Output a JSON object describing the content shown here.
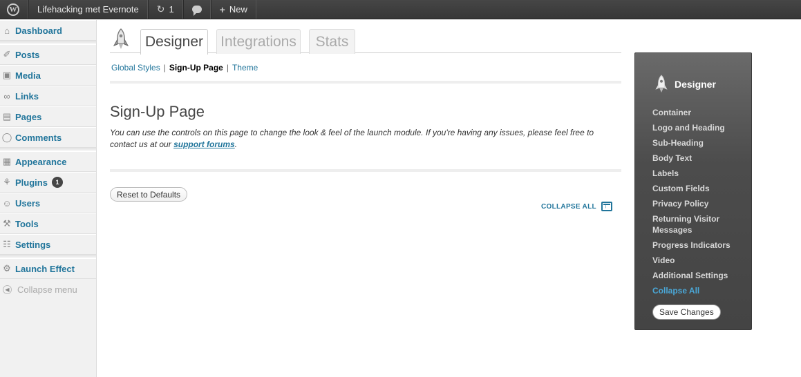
{
  "adminbar": {
    "site_name": "Lifehacking met Evernote",
    "updates_count": "1",
    "new_label": "New",
    "logo_letter": "W"
  },
  "menu": {
    "items": [
      {
        "label": "Dashboard",
        "icon": "home-icon"
      },
      {
        "label": "Posts",
        "icon": "pushpin-icon"
      },
      {
        "label": "Media",
        "icon": "media-icon"
      },
      {
        "label": "Links",
        "icon": "link-icon"
      },
      {
        "label": "Pages",
        "icon": "pages-icon"
      },
      {
        "label": "Comments",
        "icon": "comment-icon"
      },
      {
        "label": "Appearance",
        "icon": "appearance-icon"
      },
      {
        "label": "Plugins",
        "icon": "plugin-icon",
        "badge": "1"
      },
      {
        "label": "Users",
        "icon": "users-icon"
      },
      {
        "label": "Tools",
        "icon": "tools-icon"
      },
      {
        "label": "Settings",
        "icon": "settings-icon"
      },
      {
        "label": "Launch Effect",
        "icon": "launch-effect-icon"
      }
    ],
    "collapse_label": "Collapse menu"
  },
  "tabs": [
    "Designer",
    "Integrations",
    "Stats"
  ],
  "subnav": {
    "items": [
      "Global Styles",
      "Sign-Up Page",
      "Theme"
    ],
    "current": "Sign-Up Page",
    "separator": "|"
  },
  "page": {
    "title": "Sign-Up Page",
    "description": "You can use the controls on this page to change the look & feel of the launch module. If you're having any issues, please feel free to contact us at our ",
    "link_text": "support forums",
    "description_end": ".",
    "reset_label": "Reset to Defaults",
    "collapse_all_label": "COLLAPSE ALL"
  },
  "panel": {
    "title": "Designer",
    "links": [
      "Container",
      "Logo and Heading",
      "Sub-Heading",
      "Body Text",
      "Labels",
      "Custom Fields",
      "Privacy Policy",
      "Returning Visitor Messages",
      "Progress Indicators",
      "Video",
      "Additional Settings",
      "Collapse All"
    ],
    "save_label": "Save Changes"
  },
  "colors": {
    "link": "#21759b",
    "panel_highlight": "#4aa8d8",
    "adminbar_bg": "#464646"
  }
}
